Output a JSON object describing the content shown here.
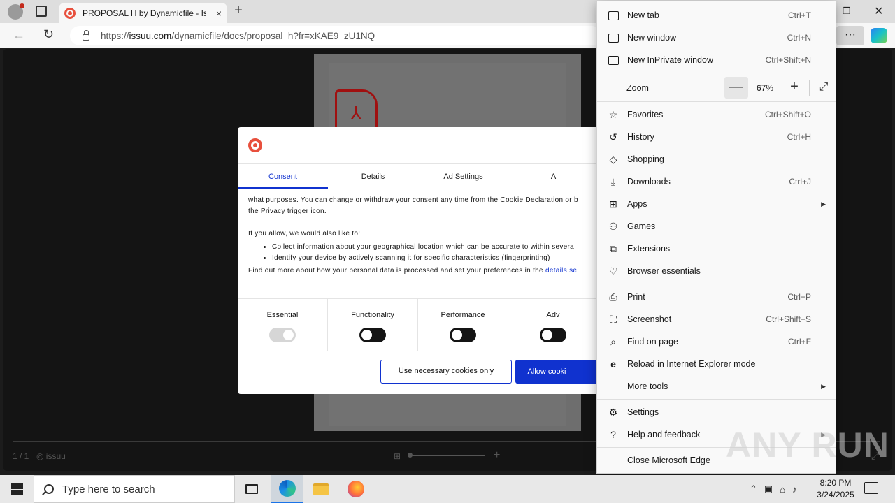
{
  "browser": {
    "tab_title": "PROPOSAL H by Dynamicfile - Issuu",
    "tab_close": "×",
    "new_tab": "+",
    "url_prefix": "https://",
    "url_domain": "issuu.com",
    "url_path": "/dynamicfile/docs/proposal_h?fr=xKAE9_zU1NQ",
    "more_button": "···",
    "back": "←",
    "reload": "↻",
    "restore": "❐",
    "close": "✕"
  },
  "viewer": {
    "page_counter": "1 / 1",
    "brand": "◎ issuu",
    "grid": "⊞",
    "zoom_in": "+",
    "fullscreen": "⤢"
  },
  "cookie_dialog": {
    "tabs": [
      "Consent",
      "Details",
      "Ad Settings",
      "A"
    ],
    "active_tab": "Consent",
    "line1": "what purposes. You can change or withdraw your consent any time from the Cookie Declaration or b",
    "line2": "the Privacy trigger icon.",
    "allow_intro": "If you allow, we would also like to:",
    "bullets": [
      "Collect information about your geographical location which can be accurate to within severa",
      "Identify your device by actively scanning it for specific characteristics (fingerprinting)"
    ],
    "find_out": "Find out more about how your personal data is processed and set your preferences in the",
    "details_link": "details se",
    "toggles": [
      {
        "label": "Essential",
        "state": "on-disabled"
      },
      {
        "label": "Functionality",
        "state": "off"
      },
      {
        "label": "Performance",
        "state": "off"
      },
      {
        "label": "Adv",
        "state": "off"
      }
    ],
    "necessary_button": "Use necessary cookies only",
    "allow_button": "Allow cooki"
  },
  "edge_menu": {
    "items": [
      {
        "label": "New tab",
        "shortcut": "Ctrl+T",
        "icon": "new-tab-icon"
      },
      {
        "label": "New window",
        "shortcut": "Ctrl+N",
        "icon": "new-window-icon"
      },
      {
        "label": "New InPrivate window",
        "shortcut": "Ctrl+Shift+N",
        "icon": "inprivate-icon"
      },
      {
        "label": "Favorites",
        "shortcut": "Ctrl+Shift+O",
        "icon": "star-icon"
      },
      {
        "label": "History",
        "shortcut": "Ctrl+H",
        "icon": "history-icon"
      },
      {
        "label": "Shopping",
        "shortcut": "",
        "icon": "shopping-tag-icon"
      },
      {
        "label": "Downloads",
        "shortcut": "Ctrl+J",
        "icon": "download-icon"
      },
      {
        "label": "Apps",
        "shortcut": "",
        "icon": "apps-icon"
      },
      {
        "label": "Games",
        "shortcut": "",
        "icon": "games-icon"
      },
      {
        "label": "Extensions",
        "shortcut": "",
        "icon": "puzzle-icon"
      },
      {
        "label": "Browser essentials",
        "shortcut": "",
        "icon": "heart-pulse-icon"
      },
      {
        "label": "Print",
        "shortcut": "Ctrl+P",
        "icon": "printer-icon"
      },
      {
        "label": "Screenshot",
        "shortcut": "Ctrl+Shift+S",
        "icon": "screenshot-icon"
      },
      {
        "label": "Find on page",
        "shortcut": "Ctrl+F",
        "icon": "find-icon"
      },
      {
        "label": "Reload in Internet Explorer mode",
        "shortcut": "",
        "icon": "ie-icon"
      },
      {
        "label": "More tools",
        "shortcut": "",
        "icon": ""
      },
      {
        "label": "Settings",
        "shortcut": "",
        "icon": "gear-icon"
      },
      {
        "label": "Help and feedback",
        "shortcut": "",
        "icon": "help-icon"
      },
      {
        "label": "Close Microsoft Edge",
        "shortcut": "",
        "icon": ""
      }
    ],
    "zoom_label": "Zoom",
    "zoom_value": "67%",
    "zoom_minus": "—",
    "zoom_plus": "+",
    "zoom_full": "⤢"
  },
  "watermark": "ANY RUN",
  "taskbar": {
    "search_placeholder": "Type here to search",
    "time": "8:20 PM",
    "date": "3/24/2025"
  }
}
